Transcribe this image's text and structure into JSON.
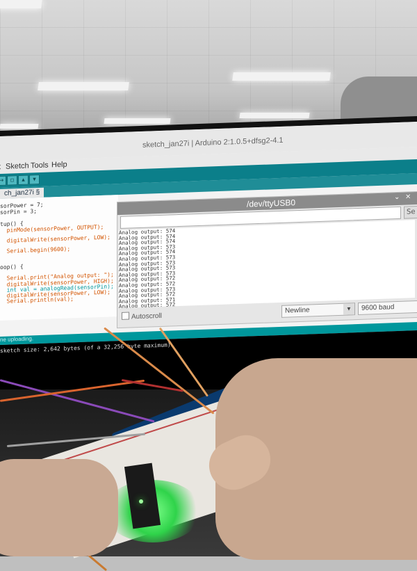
{
  "window": {
    "title": "sketch_jan27i | Arduino 2:1.0.5+dfsg2-4.1"
  },
  "menu": {
    "items": [
      "t",
      "Sketch",
      "Tools",
      "Help"
    ]
  },
  "tab": {
    "label": "ch_jan27i §"
  },
  "editor": {
    "lines": [
      "sorPower = 7;",
      "sorPin = 3;",
      "",
      "tup() {",
      "  pinMode(sensorPower, OUTPUT);",
      "",
      "  digitalWrite(sensorPower, LOW);",
      "",
      "  Serial.begin(9600);",
      "",
      "",
      "oop() {",
      "",
      "  Serial.print(\"Analog output: \");",
      "  digitalWrite(sensorPower, HIGH);",
      "  int val = analogRead(sensorPin);",
      "  digitalWrite(sensorPower, LOW);",
      "  Serial.println(val);"
    ]
  },
  "serial_monitor": {
    "title": "/dev/ttyUSB0",
    "send_label": "Se",
    "send_placeholder": "",
    "output_lines": [
      "Analog output: 574",
      "Analog output: 574",
      "Analog output: 574",
      "Analog output: 573",
      "Analog output: 574",
      "Analog output: 573",
      "Analog output: 573",
      "Analog output: 573",
      "Analog output: 573",
      "Analog output: 572",
      "Analog output: 572",
      "Analog output: 573",
      "Analog output: 572",
      "Analog output: 571",
      "Analog output: 572",
      "Analog out"
    ],
    "autoscroll_label": "Autoscroll",
    "line_ending": "Newline",
    "baud_rate": "9600 baud"
  },
  "status": {
    "bar_text": "ne uploading.",
    "console_text": "sketch size: 2,642 bytes (of a 32,256 byte maximum)"
  },
  "colors": {
    "accent": "#00979c",
    "toolbar": "#0b7f8a",
    "led_glow": "#2fd34a"
  },
  "icons": [
    "verify-icon",
    "upload-icon",
    "new-icon",
    "open-icon",
    "save-icon"
  ]
}
